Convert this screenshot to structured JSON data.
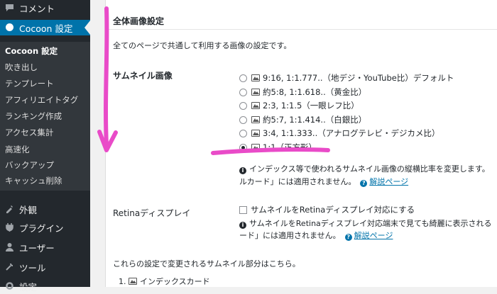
{
  "sidebar": {
    "top_items": [
      {
        "label": "コメント",
        "icon": "comment-icon"
      },
      {
        "label": "Cocoon 設定",
        "icon": "cocoon-icon",
        "active": true
      }
    ],
    "submenu": [
      {
        "label": "Cocoon 設定",
        "current": true
      },
      {
        "label": "吹き出し"
      },
      {
        "label": "テンプレート"
      },
      {
        "label": "アフィリエイトタグ"
      },
      {
        "label": "ランキング作成"
      },
      {
        "label": "アクセス集計"
      },
      {
        "label": "高速化"
      },
      {
        "label": "バックアップ"
      },
      {
        "label": "キャッシュ削除"
      }
    ],
    "bottom_items": [
      {
        "label": "外観",
        "icon": "appearance-icon"
      },
      {
        "label": "プラグイン",
        "icon": "plugin-icon"
      },
      {
        "label": "ユーザー",
        "icon": "user-icon"
      },
      {
        "label": "ツール",
        "icon": "tools-icon"
      },
      {
        "label": "設定",
        "icon": "settings-icon"
      }
    ]
  },
  "panel": {
    "title": "全体画像設定",
    "description": "全てのページで共通して利用する画像の設定です。",
    "thumbnail": {
      "label": "サムネイル画像",
      "options": [
        {
          "label": "9:16, 1:1.777..（地デジ・YouTube比）デフォルト",
          "checked": false
        },
        {
          "label": "約5:8, 1:1.618..（黄金比）",
          "checked": false
        },
        {
          "label": "2:3, 1:1.5（一眼レフ比）",
          "checked": false
        },
        {
          "label": "約5:7, 1:1.414..（白銀比）",
          "checked": false
        },
        {
          "label": "3:4, 1:1.333..（アナログテレビ・デジカメ比）",
          "checked": false
        },
        {
          "label": "1:1（正方形）",
          "checked": true
        }
      ],
      "info_line1": "インデックス等で使われるサムネイル画像の縦横比率を変更します。",
      "info_line2": "ルカード」には適用されません。",
      "help_link": "解説ページ"
    },
    "retina": {
      "label": "Retinaディスプレイ",
      "checkbox_label": "サムネイルをRetinaディスプレイ対応にする",
      "checked": false,
      "info_line1": "サムネイルをRetinaディスプレイ対応端末で見ても綺麗に表示される",
      "info_line2": "ード」には適用されません。",
      "help_link": "解説ページ"
    },
    "note": "これらの設定で変更されるサムネイル部分はこちら。",
    "list": [
      {
        "num": "1.",
        "label": "インデックスカード"
      }
    ]
  },
  "colors": {
    "sidebar_bg": "#23282d",
    "submenu_bg": "#32373c",
    "active_bg": "#0073aa",
    "link": "#0073aa",
    "annotation": "#e94bc8"
  }
}
